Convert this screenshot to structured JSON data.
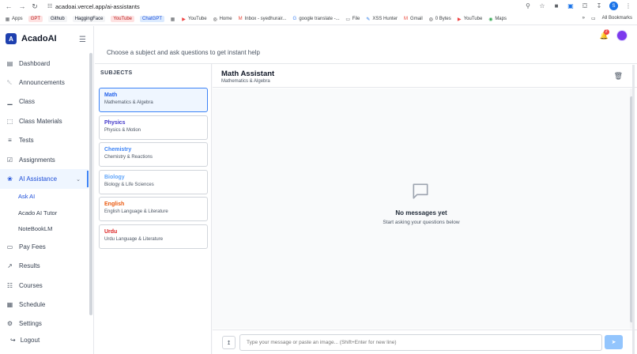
{
  "browser": {
    "url": "acadoai.vercel.app/ai-assistants",
    "profile_initial": "S",
    "bookmarks": [
      {
        "label": "Apps",
        "icon": "grid-icon"
      },
      {
        "label": "GPT",
        "style": "red"
      },
      {
        "label": "Github",
        "style": "gray"
      },
      {
        "label": "HaggingFace",
        "style": "gray"
      },
      {
        "label": "YouTube",
        "style": "red"
      },
      {
        "label": "ChatGPT",
        "style": "blue"
      },
      {
        "label": "",
        "icon": "grid-icon"
      },
      {
        "label": "YouTube",
        "icon": "youtube-icon"
      },
      {
        "label": "Home",
        "icon": "globe-icon"
      },
      {
        "label": "Inbox - syedhurair...",
        "icon": "gmail-icon"
      },
      {
        "label": "google translate -...",
        "icon": "google-icon"
      },
      {
        "label": "File",
        "icon": "folder-icon"
      },
      {
        "label": "XSS Hunter",
        "icon": "pen-icon"
      },
      {
        "label": "Gmail",
        "icon": "gmail-icon"
      },
      {
        "label": "0 Bytes",
        "icon": "globe-icon"
      },
      {
        "label": "YouTube",
        "icon": "youtube-icon"
      },
      {
        "label": "Maps",
        "icon": "maps-icon"
      }
    ],
    "all_bookmarks": "All Bookmarks"
  },
  "app": {
    "brand": "AcadoAI",
    "brand_letter": "A",
    "subtitle": "Choose a subject and ask questions to get instant help",
    "notification_count": "2"
  },
  "sidebar": {
    "items": [
      {
        "label": "Dashboard",
        "icon": "dashboard-icon"
      },
      {
        "label": "Announcements",
        "icon": "bell-icon"
      },
      {
        "label": "Class",
        "icon": "chart-icon"
      },
      {
        "label": "Class Materials",
        "icon": "book-icon"
      },
      {
        "label": "Tests",
        "icon": "document-icon"
      },
      {
        "label": "Assignments",
        "icon": "clipboard-icon"
      },
      {
        "label": "AI Assistance",
        "icon": "ai-icon"
      }
    ],
    "sub_items": [
      {
        "label": "Ask AI"
      },
      {
        "label": "Acado AI Tutor"
      },
      {
        "label": "NoteBookLM"
      }
    ],
    "lower_items": [
      {
        "label": "Pay Fees",
        "icon": "card-icon"
      },
      {
        "label": "Results",
        "icon": "trend-icon"
      },
      {
        "label": "Courses",
        "icon": "book-open-icon"
      },
      {
        "label": "Schedule",
        "icon": "calendar-icon"
      },
      {
        "label": "Settings",
        "icon": "gear-icon"
      }
    ],
    "logout": "Logout"
  },
  "subjects": {
    "title": "SUBJECTS",
    "items": [
      {
        "name": "Math",
        "desc": "Mathematics & Algebra",
        "color": "#2563eb"
      },
      {
        "name": "Physics",
        "desc": "Physics & Motion",
        "color": "#4338ca"
      },
      {
        "name": "Chemistry",
        "desc": "Chemistry & Reactions",
        "color": "#3b82f6"
      },
      {
        "name": "Biology",
        "desc": "Biology & Life Sciences",
        "color": "#60a5fa"
      },
      {
        "name": "English",
        "desc": "English Language & Literature",
        "color": "#ea580c"
      },
      {
        "name": "Urdu",
        "desc": "Urdu Language & Literature",
        "color": "#dc2626"
      }
    ]
  },
  "chat": {
    "title": "Math Assistant",
    "subtitle": "Mathematics & Algebra",
    "empty_title": "No messages yet",
    "empty_sub": "Start asking your questions below",
    "input_placeholder": "Type your message or paste an image... (Shift+Enter for new line)"
  }
}
